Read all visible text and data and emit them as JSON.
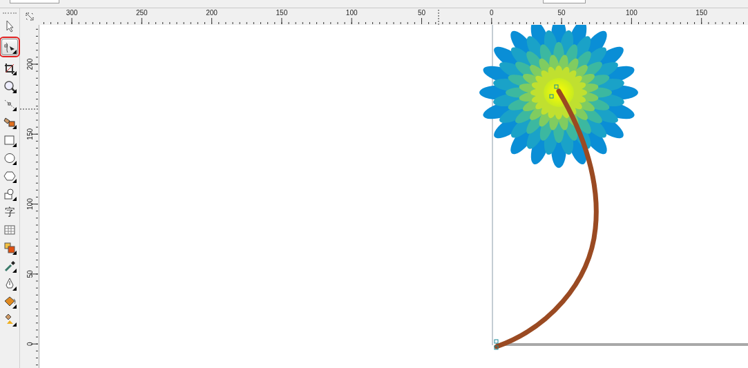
{
  "toolbox": {
    "tools": [
      {
        "kind": "pointer",
        "selected": false,
        "highlighted": false
      },
      {
        "kind": "shape",
        "selected": true,
        "highlighted": true
      },
      {
        "kind": "crop",
        "selected": false,
        "highlighted": false
      },
      {
        "kind": "zoom",
        "selected": false,
        "highlighted": false
      },
      {
        "kind": "curve",
        "selected": false,
        "highlighted": false
      },
      {
        "kind": "smartfill",
        "selected": false,
        "highlighted": false
      },
      {
        "kind": "rectangle",
        "selected": false,
        "highlighted": false
      },
      {
        "kind": "ellipse",
        "selected": false,
        "highlighted": false
      },
      {
        "kind": "polygon",
        "selected": false,
        "highlighted": false
      },
      {
        "kind": "basicshapes",
        "selected": false,
        "highlighted": false
      },
      {
        "kind": "text",
        "glyph": "字",
        "selected": false,
        "highlighted": false
      },
      {
        "kind": "table",
        "selected": false,
        "highlighted": false
      },
      {
        "kind": "effects",
        "selected": false,
        "highlighted": false
      },
      {
        "kind": "eyedropper",
        "selected": false,
        "highlighted": false
      },
      {
        "kind": "outline",
        "selected": false,
        "highlighted": false
      },
      {
        "kind": "fill",
        "selected": false,
        "highlighted": false
      },
      {
        "kind": "interactivefill",
        "selected": false,
        "highlighted": false
      }
    ]
  },
  "top_ruler": {
    "labels": [
      "300",
      "250",
      "200",
      "150",
      "100",
      "50",
      "0",
      "50",
      "100",
      "150"
    ]
  },
  "left_ruler": {
    "labels": [
      "200",
      "150",
      "100",
      "50",
      "0"
    ]
  }
}
